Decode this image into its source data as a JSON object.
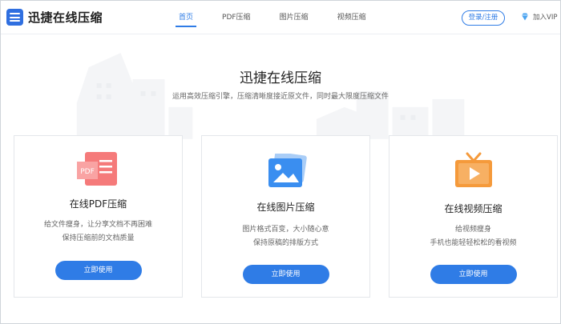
{
  "header": {
    "logo_text": "迅捷在线压缩",
    "nav": [
      "首页",
      "PDF压缩",
      "图片压缩",
      "视频压缩"
    ],
    "login_label": "登录/注册",
    "vip_label": "加入VIP"
  },
  "hero": {
    "title": "迅捷在线压缩",
    "subtitle": "运用高效压缩引擎，压缩清晰度接近原文件，同时最大限度压缩文件"
  },
  "cards": [
    {
      "title": "在线PDF压缩",
      "desc": [
        "给文件瘦身，让分享文档不再困难",
        "保持压缩前的文档质量"
      ],
      "button": "立即使用",
      "icon_text": "PDF",
      "icon": "pdf-file-icon"
    },
    {
      "title": "在线图片压缩",
      "desc": [
        "图片格式百变，大小随心意",
        "保持原稿的排版方式"
      ],
      "button": "立即使用",
      "icon": "image-icon"
    },
    {
      "title": "在线视频压缩",
      "desc": [
        "给视频瘦身",
        "手机也能轻轻松松的看视频"
      ],
      "button": "立即使用",
      "icon": "tv-play-icon"
    }
  ],
  "colors": {
    "accent": "#2f7ce6",
    "pdf": "#f26b6b",
    "image": "#3a8ef0",
    "video": "#f59a3b"
  }
}
